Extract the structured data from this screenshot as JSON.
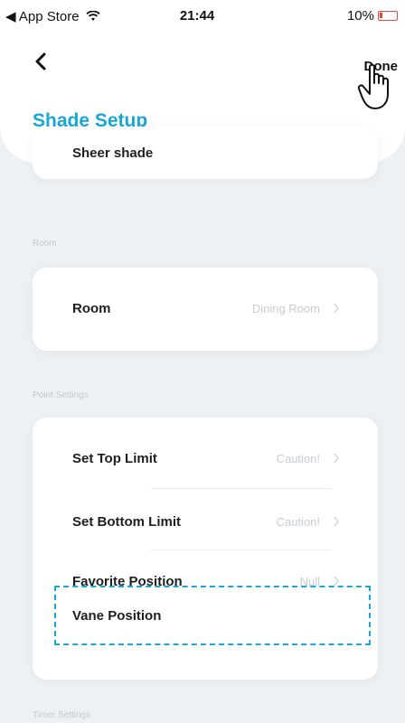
{
  "status_bar": {
    "back_app": "◀ App Store",
    "time": "21:44",
    "battery": "10%"
  },
  "nav": {
    "done_label": "Done"
  },
  "page": {
    "title": "Shade Setup"
  },
  "shade_name": {
    "label": "Sheer shade"
  },
  "room_section": {
    "header": "Room",
    "row_label": "Room",
    "row_value": "Dining Room"
  },
  "point_settings": {
    "header": "Point Settings",
    "rows": [
      {
        "label": "Set Top Limit",
        "value": "Caution!"
      },
      {
        "label": "Set Bottom Limit",
        "value": "Caution!"
      },
      {
        "label": "Favorite Position",
        "value": "Null"
      },
      {
        "label": "Vane Position",
        "value": ""
      }
    ]
  },
  "timer_section": {
    "header": "Timer Settings"
  },
  "colors": {
    "accent": "#18a7d6",
    "background": "#eef1f3",
    "battery": "#e24a3d"
  }
}
